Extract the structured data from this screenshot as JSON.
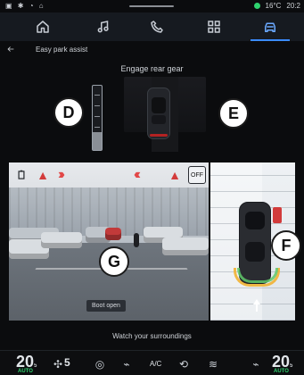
{
  "status": {
    "left_icons": "▣ ✱ ◔ ⌂",
    "temperature": "16°C",
    "time": "20:2"
  },
  "nav": {
    "tabs": [
      {
        "name": "home",
        "active": false
      },
      {
        "name": "music",
        "active": false
      },
      {
        "name": "phone",
        "active": false
      },
      {
        "name": "apps",
        "active": false
      },
      {
        "name": "car",
        "active": true
      }
    ]
  },
  "header": {
    "back_label": "←",
    "breadcrumb": "Easy park assist"
  },
  "instruction": "Engage rear gear",
  "labels": {
    "D": "D",
    "E": "E",
    "F": "F",
    "G": "G"
  },
  "camera": {
    "boot_open": "Boot open",
    "off_badge": "OFF"
  },
  "footer": {
    "message": "Watch your surroundings"
  },
  "climate": {
    "left_temp": "20",
    "left_unit": "5",
    "fan_level": "5",
    "ac_label": "A/C",
    "right_temp": "20",
    "right_unit": "5",
    "left_auto": "AUTO",
    "right_auto": "AUTO"
  }
}
